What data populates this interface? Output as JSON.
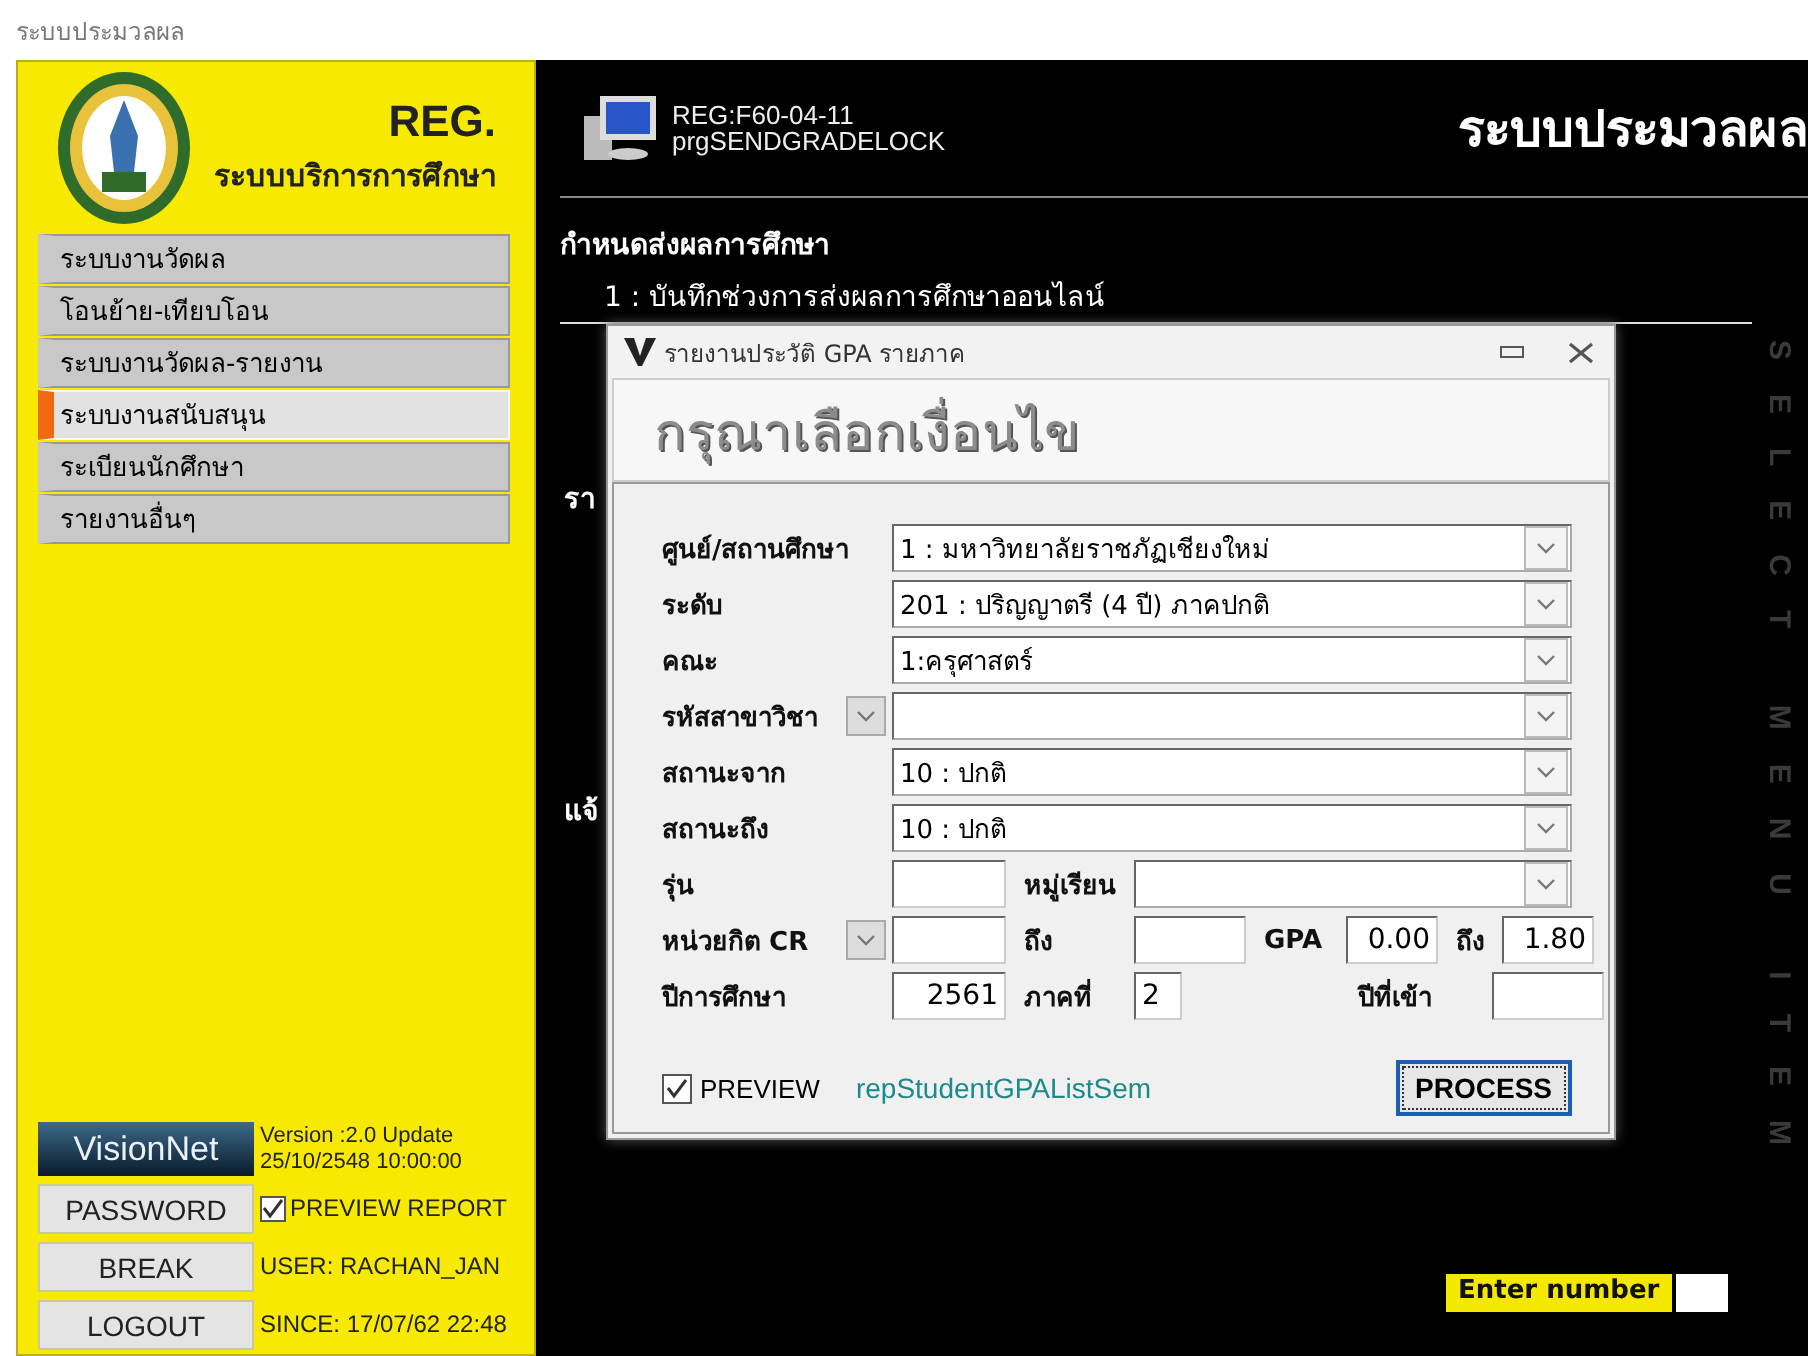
{
  "window": {
    "title": "ระบบประมวลผล"
  },
  "sidebar": {
    "logo_title": "REG.",
    "logo_subtitle": "ระบบบริการการศึกษา",
    "menu": [
      {
        "label": "ระบบงานวัดผล",
        "selected": false
      },
      {
        "label": "โอนย้าย-เทียบโอน",
        "selected": false
      },
      {
        "label": "ระบบงานวัดผล-รายงาน",
        "selected": false
      },
      {
        "label": "ระบบงานสนับสนุน",
        "selected": true
      },
      {
        "label": "ระเบียนนักศึกษา",
        "selected": false
      },
      {
        "label": "รายงานอื่นๆ",
        "selected": false
      }
    ],
    "brand": "VisionNet",
    "version": "Version :2.0 Update",
    "version_date": "25/10/2548 10:00:00",
    "buttons": [
      "PASSWORD",
      "BREAK",
      "LOGOUT"
    ],
    "preview_report": {
      "label": "PREVIEW REPORT",
      "checked": true
    },
    "user": "USER: RACHAN_JAN",
    "since": "SINCE: 17/07/62 22:48"
  },
  "header": {
    "program_code": "REG:F60-04-11",
    "program_name": "prgSENDGRADELOCK",
    "title": "ระบบประมวลผล"
  },
  "content": {
    "section": "กำหนดส่งผลการศึกษา",
    "item": "1 : บันทึกช่วงการส่งผลการศึกษาออนไลน์",
    "partial_texts": [
      "รา",
      "แจ้"
    ],
    "side_caption": "SELECT MENU ITEM",
    "enter_number": "Enter number"
  },
  "dialog": {
    "title": "รายงานประวัติ GPA รายภาค",
    "heading": "กรุณาเลือกเงื่อนไข",
    "rows": [
      [
        {
          "kind": "label",
          "text": "ศูนย์/สถานศึกษา"
        },
        {
          "kind": "select",
          "value": "1 : มหาวิทยาลัยราชภัฏเชียงใหม่"
        }
      ],
      [
        {
          "kind": "label",
          "text": "ระดับ"
        },
        {
          "kind": "select",
          "value": "201 : ปริญญาตรี (4 ปี) ภาคปกติ"
        }
      ],
      [
        {
          "kind": "label",
          "text": "คณะ"
        },
        {
          "kind": "select",
          "value": "1:ครุศาสตร์"
        }
      ],
      [
        {
          "kind": "label_dropdown",
          "text": "รหัสสาขาวิชา"
        },
        {
          "kind": "select"
        }
      ],
      [
        {
          "kind": "label",
          "text": "สถานะจาก"
        },
        {
          "kind": "select",
          "value": "10 : ปกติ"
        }
      ],
      [
        {
          "kind": "label",
          "text": "สถานะถึง"
        },
        {
          "kind": "select",
          "value": "10 : ปกติ"
        }
      ],
      [
        {
          "kind": "label",
          "text": "รุ่น"
        },
        {
          "kind": "input"
        },
        {
          "kind": "label",
          "text": "หมู่เรียน"
        },
        {
          "kind": "select"
        }
      ],
      [
        {
          "kind": "label_dropdown",
          "text": "หน่วยกิต CR"
        },
        {
          "kind": "input"
        },
        {
          "kind": "label",
          "text": "ถึง"
        },
        {
          "kind": "input"
        },
        {
          "kind": "label",
          "text": "GPA"
        },
        {
          "kind": "input",
          "value": "0.00"
        },
        {
          "kind": "label",
          "text": "ถึง"
        },
        {
          "kind": "input",
          "value": "1.80"
        }
      ],
      [
        {
          "kind": "label",
          "text": "ปีการศึกษา"
        },
        {
          "kind": "input",
          "value": "2561"
        },
        {
          "kind": "label",
          "text": "ภาคที่"
        },
        {
          "kind": "input",
          "value": "2"
        },
        {
          "kind": "empty"
        },
        {
          "kind": "label",
          "text": "ปีที่เข้า"
        },
        {
          "kind": "input"
        }
      ]
    ],
    "preview": {
      "label": "PREVIEW",
      "checked": true
    },
    "report_name": "repStudentGPAListSem",
    "button": "PROCESS"
  }
}
